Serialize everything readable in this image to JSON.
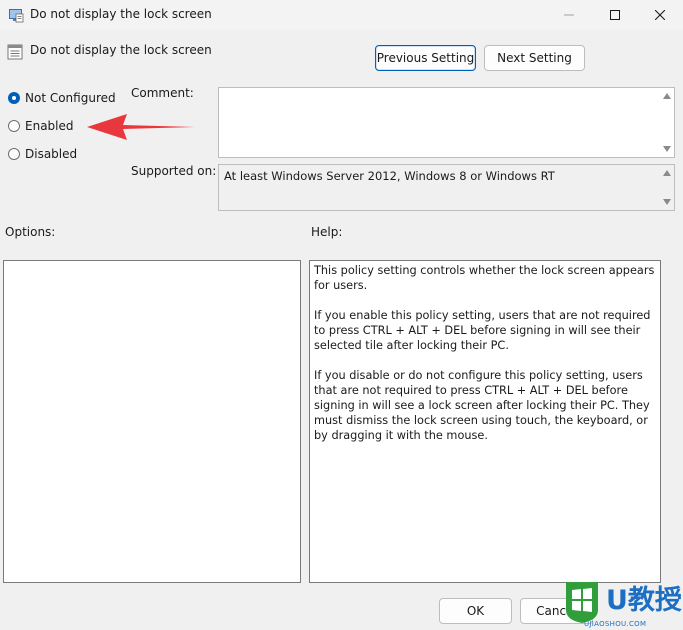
{
  "window": {
    "title": "Do not display the lock screen",
    "minimize_icon": "minimize-icon",
    "maximize_icon": "maximize-icon",
    "close_icon": "close-icon"
  },
  "header": {
    "policy_name": "Do not display the lock screen",
    "previous_label": "Previous Setting",
    "next_label": "Next Setting"
  },
  "state": {
    "options": [
      {
        "label": "Not Configured",
        "selected": true
      },
      {
        "label": "Enabled",
        "selected": false
      },
      {
        "label": "Disabled",
        "selected": false
      }
    ]
  },
  "comment": {
    "label": "Comment:",
    "value": ""
  },
  "supported": {
    "label": "Supported on:",
    "value": "At least Windows Server 2012, Windows 8 or Windows RT"
  },
  "options_panel": {
    "label": "Options:"
  },
  "help": {
    "label": "Help:",
    "paragraphs": [
      "This policy setting controls whether the lock screen appears for users.",
      "If you enable this policy setting, users that are not required to press CTRL + ALT + DEL before signing in will see their selected tile after locking their PC.",
      "If you disable or do not configure this policy setting, users that are not required to press CTRL + ALT + DEL before signing in will see a lock screen after locking their PC. They must dismiss the lock screen using touch, the keyboard, or by dragging it with the mouse."
    ]
  },
  "footer": {
    "ok_label": "OK",
    "cancel_label": "Cancel"
  },
  "annotation": {
    "arrow_color": "#e8383d"
  },
  "watermark": {
    "brand": "U教授",
    "site": "UJIAOSHOU.COM"
  },
  "colors": {
    "accent": "#005fb8",
    "watermark": "#1d6fc4"
  }
}
